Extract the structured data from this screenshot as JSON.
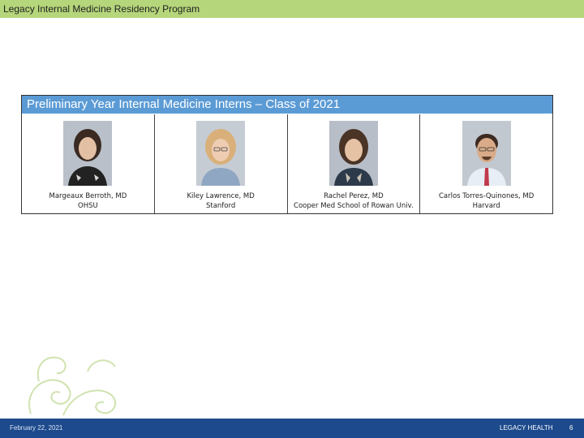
{
  "header": {
    "title": "Legacy Internal Medicine Residency Program"
  },
  "slide": {
    "heading": "Preliminary Year Internal Medicine Interns – Class of 2021",
    "interns": [
      {
        "name": "Margeaux Berroth, MD",
        "school": "OHSU"
      },
      {
        "name": "Kiley Lawrence, MD",
        "school": "Stanford"
      },
      {
        "name": "Rachel Perez, MD",
        "school": "Cooper Med School of Rowan Univ."
      },
      {
        "name": "Carlos Torres-Quinones, MD",
        "school": "Harvard"
      }
    ]
  },
  "footer": {
    "date": "February 22, 2021",
    "org": "LEGACY HEALTH",
    "page": "6"
  },
  "colors": {
    "banner": "#b5d67a",
    "heading_bar": "#5b9bd5",
    "footer": "#1d4a8c"
  }
}
